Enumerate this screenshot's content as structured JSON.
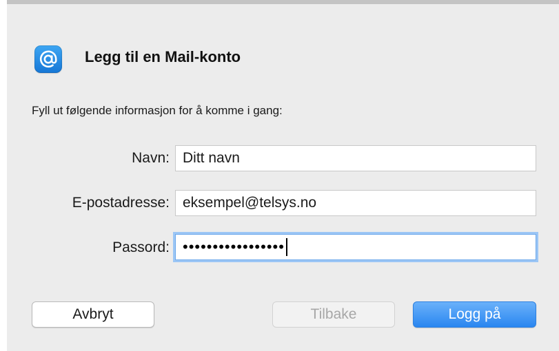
{
  "dialog": {
    "title": "Legg til en Mail-konto",
    "intro": "Fyll ut følgende informasjon for å komme i gang:",
    "icon": "at-sign-icon",
    "accent_color": "#2a86f0"
  },
  "form": {
    "name": {
      "label": "Navn:",
      "value": "Ditt navn"
    },
    "email": {
      "label": "E-postadresse:",
      "value": "eksempel@telsys.no"
    },
    "password": {
      "label": "Passord:",
      "masked_value": "•••••••••••••••••"
    }
  },
  "buttons": {
    "cancel": "Avbryt",
    "back": "Tilbake",
    "login": "Logg på"
  }
}
